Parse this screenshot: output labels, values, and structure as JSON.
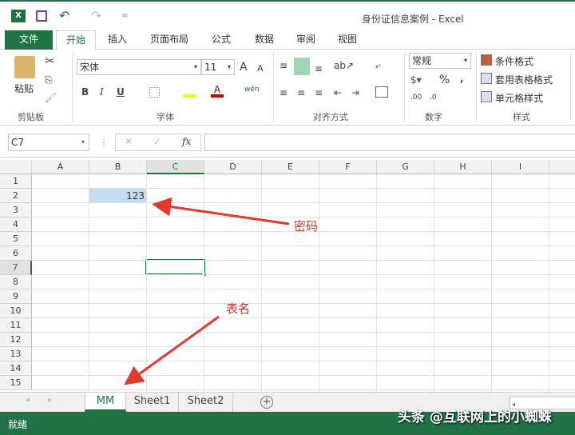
{
  "window": {
    "title": "身份证信息案例 - Excel"
  },
  "quick_access": {
    "undo": "↶",
    "redo": "↷",
    "customize": "="
  },
  "tabs": [
    {
      "label": "文件"
    },
    {
      "label": "开始"
    },
    {
      "label": "插入"
    },
    {
      "label": "页面布局"
    },
    {
      "label": "公式"
    },
    {
      "label": "数据"
    },
    {
      "label": "审阅"
    },
    {
      "label": "视图"
    }
  ],
  "ribbon": {
    "clipboard": {
      "paste": "粘贴",
      "label": "剪贴板"
    },
    "font": {
      "name": "宋体",
      "size": "11",
      "bold": "B",
      "italic": "I",
      "underline": "U",
      "grow": "A",
      "shrink": "A",
      "phonetic": "wén",
      "label": "字体"
    },
    "alignment": {
      "label": "对齐方式"
    },
    "number": {
      "format": "常规",
      "percent": "%",
      "comma": ",",
      "inc_decimal": ".00",
      "dec_decimal": ".0",
      "label": "数字"
    },
    "styles": {
      "conditional": "条件格式",
      "table": "套用表格格式",
      "cell": "单元格样式",
      "label": "样式"
    }
  },
  "formula_bar": {
    "name_box": "C7",
    "fx": "fx",
    "cancel": "✕",
    "enter": "✓",
    "value": ""
  },
  "columns": [
    "A",
    "B",
    "C",
    "D",
    "E",
    "F",
    "G",
    "H",
    "I"
  ],
  "rows": [
    "1",
    "2",
    "3",
    "4",
    "5",
    "6",
    "7",
    "8",
    "9",
    "10",
    "11",
    "12",
    "13",
    "14",
    "15"
  ],
  "cells": {
    "B2": "123"
  },
  "annotations": {
    "password": "密码",
    "sheet_name": "表名"
  },
  "sheets": [
    {
      "label": "MM",
      "active": true
    },
    {
      "label": "Sheet1"
    },
    {
      "label": "Sheet2"
    }
  ],
  "add_sheet": "+",
  "status": {
    "text": "就绪",
    "watermark": "头条 @互联网上的小蜘蛛"
  },
  "colors": {
    "accent": "#217346",
    "annotation": "#d93025",
    "selection": "#c6dcf0"
  }
}
